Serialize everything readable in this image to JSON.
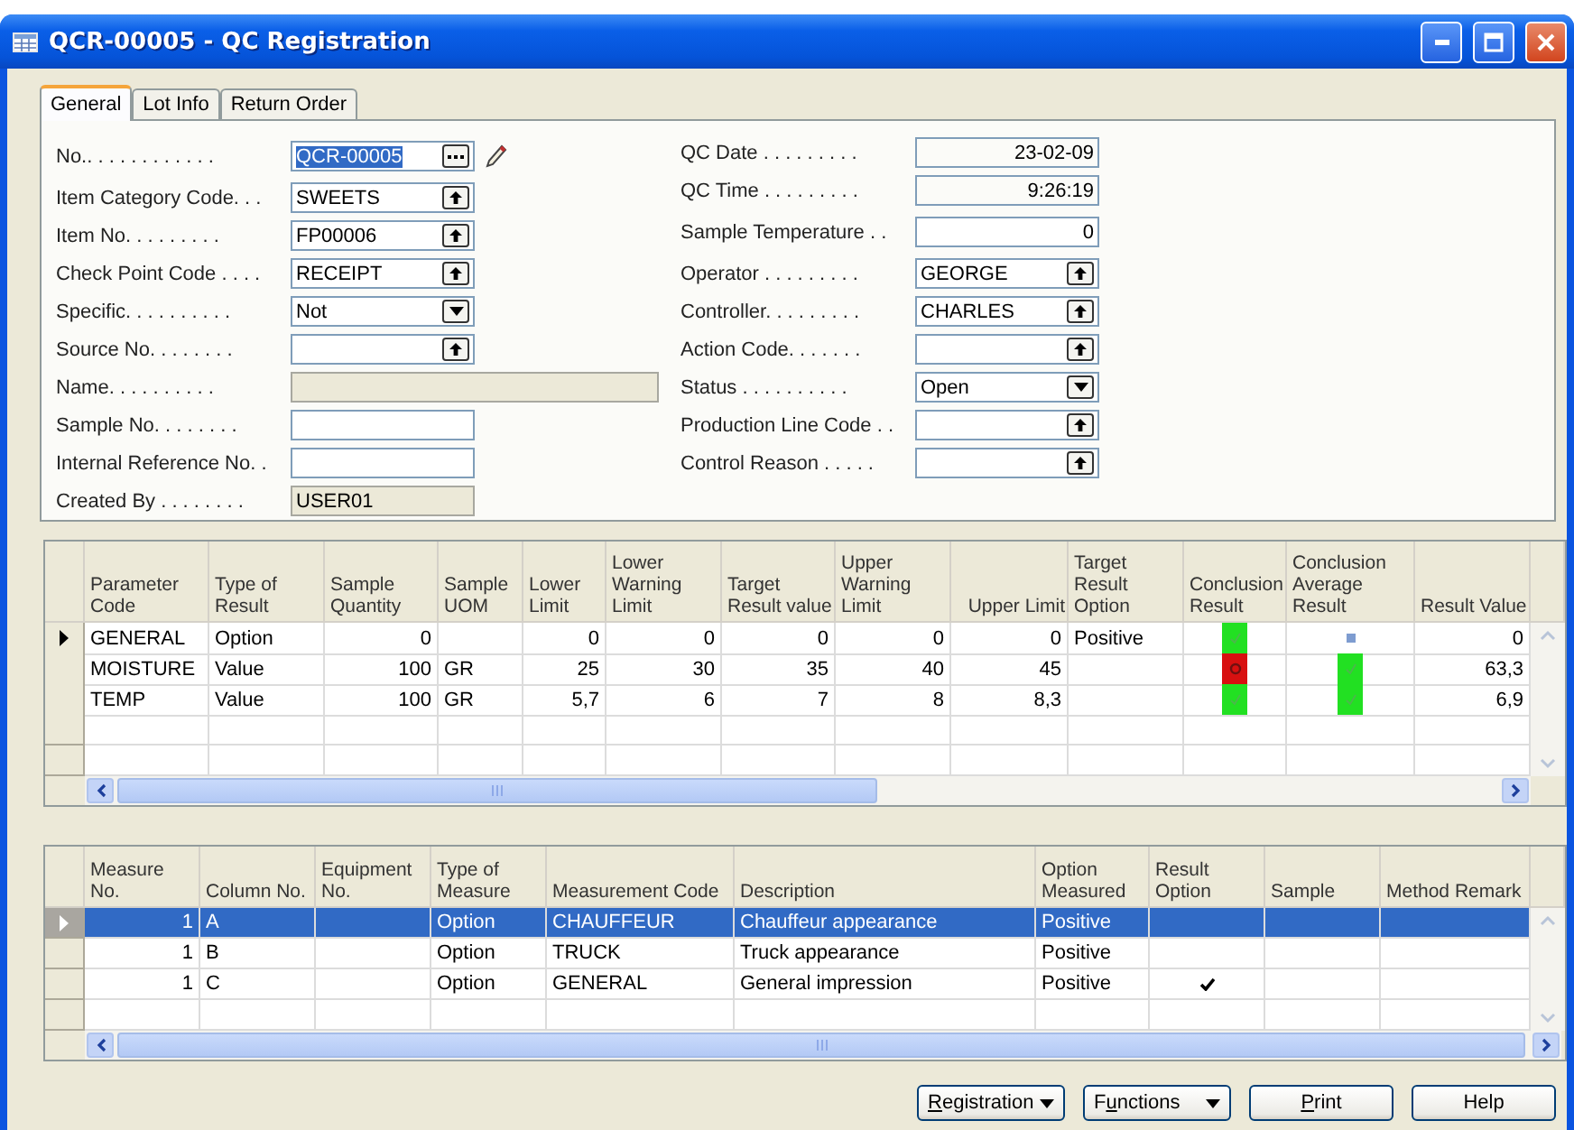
{
  "window": {
    "title": "QCR-00005 - QC Registration"
  },
  "tabs": [
    {
      "label": "General",
      "selected": true
    },
    {
      "label": "Lot Info",
      "selected": false
    },
    {
      "label": "Return Order",
      "selected": false
    }
  ],
  "form": {
    "left": [
      {
        "label": "No.. . . . . . . . . . . .",
        "value": "QCR-00005",
        "kind": "assist",
        "text_selected": true,
        "wide": false
      },
      {
        "label": "Item Category Code. . .",
        "value": "SWEETS",
        "kind": "lookup",
        "text_selected": false,
        "wide": false
      },
      {
        "label": "Item No. . . . . . . . .",
        "value": "FP00006",
        "kind": "lookup",
        "text_selected": false,
        "wide": false
      },
      {
        "label": "Check Point Code . . . .",
        "value": "RECEIPT",
        "kind": "lookup",
        "text_selected": false,
        "wide": false
      },
      {
        "label": "Specific. . . . . . . . . .",
        "value": "Not",
        "kind": "dropdown",
        "text_selected": false,
        "wide": false
      },
      {
        "label": "Source No. . . . . . . .",
        "kind": "lookup",
        "wide": false
      },
      {
        "label": "Name. . . . . . . . . .",
        "kind": "disabled",
        "wide": true
      },
      {
        "label": "Sample No. . . . . . . .",
        "kind": "text",
        "wide": false
      },
      {
        "label": "Internal Reference No. .",
        "kind": "text",
        "wide": false
      },
      {
        "label": "Created By . . . . . . . .",
        "value": "USER01",
        "kind": "disabled",
        "text_selected": false,
        "wide": false
      }
    ],
    "right": [
      {
        "label": "QC Date . . . . . . . . .",
        "value": "23-02-09",
        "kind": "display",
        "text_selected": false,
        "wide": false
      },
      {
        "label": "QC Time . . . . . . . . .",
        "value": "9:26:19",
        "kind": "display",
        "text_selected": false,
        "wide": false
      },
      {
        "label": "Sample Temperature . .",
        "value": "0",
        "kind": "number",
        "text_selected": false,
        "wide": false
      },
      {
        "label": "Operator . . . . . . . . .",
        "value": "GEORGE",
        "kind": "lookup",
        "text_selected": false,
        "wide": false
      },
      {
        "label": "Controller. . . . . . . . .",
        "value": "CHARLES",
        "kind": "lookup",
        "text_selected": false,
        "wide": false
      },
      {
        "label": "Action Code. . . . . . .",
        "kind": "lookup",
        "wide": false
      },
      {
        "label": "Status . . . . . . . . . .",
        "value": "Open",
        "kind": "dropdown",
        "text_selected": false,
        "wide": false
      },
      {
        "label": "Production Line Code . .",
        "kind": "lookup",
        "wide": false
      },
      {
        "label": "Control Reason . . . . .",
        "kind": "lookup",
        "wide": false
      }
    ]
  },
  "parameters_table": {
    "columns": [
      {
        "label": "Parameter Code",
        "kind": "text"
      },
      {
        "label": "Type of Result",
        "kind": "text"
      },
      {
        "label": "Sample Quantity",
        "kind": "number"
      },
      {
        "label": "Sample UOM",
        "kind": "text"
      },
      {
        "label": "Lower Limit",
        "kind": "number"
      },
      {
        "label": "Lower Warning Limit",
        "kind": "number"
      },
      {
        "label": "Target Result value",
        "kind": "number"
      },
      {
        "label": "Upper Warning Limit",
        "kind": "number"
      },
      {
        "label": "Upper Limit",
        "kind": "number"
      },
      {
        "label": "Target Result Option",
        "kind": "text"
      },
      {
        "label": "Conclusion Result",
        "kind": "status"
      },
      {
        "label": "Conclusion Average Result",
        "kind": "status"
      },
      {
        "label": "Result Value",
        "kind": "number"
      }
    ],
    "rows": [
      {
        "current": true,
        "selected": false,
        "cells": [
          "GENERAL",
          "Option",
          "0",
          "",
          "0",
          "0",
          "0",
          "0",
          "0",
          "Positive",
          {
            "kind": "pass"
          },
          {
            "kind": "none"
          },
          "0"
        ]
      },
      {
        "current": false,
        "selected": false,
        "cells": [
          "MOISTURE",
          "Value",
          "100",
          "GR",
          "25",
          "30",
          "35",
          "40",
          "45",
          "",
          {
            "kind": "fail"
          },
          {
            "kind": "pass"
          },
          "63,3"
        ]
      },
      {
        "current": false,
        "selected": false,
        "cells": [
          "TEMP",
          "Value",
          "100",
          "GR",
          "5,7",
          "6",
          "7",
          "8",
          "8,3",
          "",
          {
            "kind": "pass"
          },
          {
            "kind": "pass"
          },
          "6,9"
        ]
      }
    ]
  },
  "measures_table": {
    "columns": [
      {
        "label": "Measure No.",
        "kind": "number"
      },
      {
        "label": "Column No.",
        "kind": "text"
      },
      {
        "label": "Equipment No.",
        "kind": "text"
      },
      {
        "label": "Type of Measure",
        "kind": "text"
      },
      {
        "label": "Measurement Code",
        "kind": "text"
      },
      {
        "label": "Description",
        "kind": "text"
      },
      {
        "label": "Option Measured",
        "kind": "text"
      },
      {
        "label": "Result Option",
        "kind": "check"
      },
      {
        "label": "Sample",
        "kind": "text"
      },
      {
        "label": "Method Remark",
        "kind": "text"
      }
    ],
    "rows": [
      {
        "current": true,
        "selected": true,
        "cells": [
          "1",
          "A",
          "",
          "Option",
          "CHAUFFEUR",
          "Chauffeur appearance",
          "Positive",
          false,
          "",
          ""
        ]
      },
      {
        "current": false,
        "selected": false,
        "cells": [
          "1",
          "B",
          "",
          "Option",
          "TRUCK",
          "Truck appearance",
          "Positive",
          false,
          "",
          ""
        ]
      },
      {
        "current": false,
        "selected": false,
        "cells": [
          "1",
          "C",
          "",
          "Option",
          "GENERAL",
          "General impression",
          "Positive",
          true,
          "",
          ""
        ]
      }
    ]
  },
  "buttons": [
    {
      "label_parts": [
        {
          "text": "R",
          "underline": true
        },
        {
          "text": "egistration",
          "underline": false
        }
      ],
      "menu": true
    },
    {
      "label_parts": [
        {
          "text": "F",
          "underline": false
        },
        {
          "text": "u",
          "underline": true
        },
        {
          "text": "nctions",
          "underline": false
        }
      ],
      "menu": true
    },
    {
      "label_parts": [
        {
          "text": "P",
          "underline": true
        },
        {
          "text": "rint",
          "underline": false
        }
      ],
      "menu": false
    },
    {
      "label_parts": [
        {
          "text": "Help",
          "underline": false
        }
      ],
      "menu": false
    }
  ]
}
